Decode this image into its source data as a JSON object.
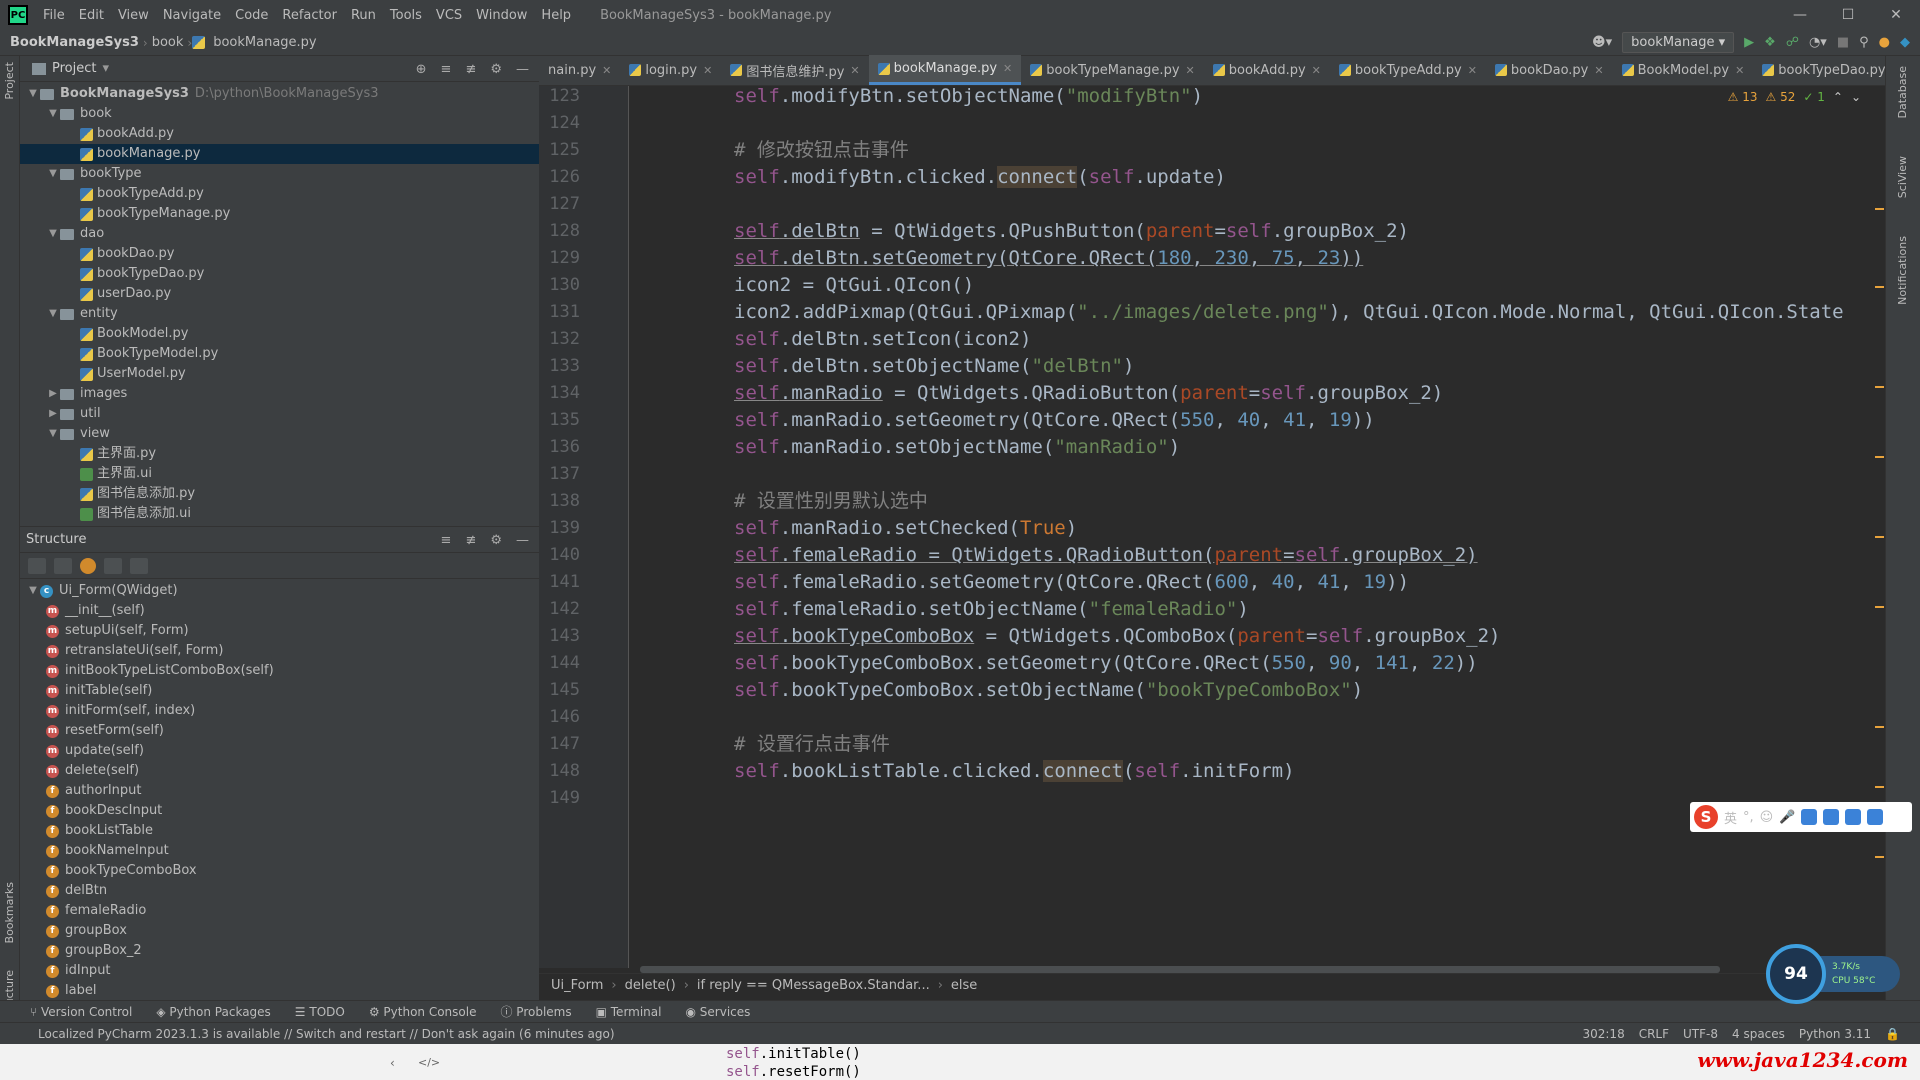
{
  "window": {
    "title": "BookManageSys3 - bookManage.py",
    "menu": [
      "File",
      "Edit",
      "View",
      "Navigate",
      "Code",
      "Refactor",
      "Run",
      "Tools",
      "VCS",
      "Window",
      "Help"
    ]
  },
  "navbar": {
    "crumbs": [
      "BookManageSys3",
      "book",
      "bookManage.py"
    ],
    "run_config": "bookManage"
  },
  "project": {
    "title": "Project",
    "tree": [
      {
        "label": "BookManageSys3",
        "path": "D:\\python\\BookManageSys3",
        "level": 0,
        "kind": "root"
      },
      {
        "label": "book",
        "level": 1,
        "kind": "folder"
      },
      {
        "label": "bookAdd.py",
        "level": 2,
        "kind": "py"
      },
      {
        "label": "bookManage.py",
        "level": 2,
        "kind": "py",
        "selected": true
      },
      {
        "label": "bookType",
        "level": 1,
        "kind": "folder"
      },
      {
        "label": "bookTypeAdd.py",
        "level": 2,
        "kind": "py"
      },
      {
        "label": "bookTypeManage.py",
        "level": 2,
        "kind": "py"
      },
      {
        "label": "dao",
        "level": 1,
        "kind": "folder"
      },
      {
        "label": "bookDao.py",
        "level": 2,
        "kind": "py"
      },
      {
        "label": "bookTypeDao.py",
        "level": 2,
        "kind": "py"
      },
      {
        "label": "userDao.py",
        "level": 2,
        "kind": "py"
      },
      {
        "label": "entity",
        "level": 1,
        "kind": "folder"
      },
      {
        "label": "BookModel.py",
        "level": 2,
        "kind": "py"
      },
      {
        "label": "BookTypeModel.py",
        "level": 2,
        "kind": "py"
      },
      {
        "label": "UserModel.py",
        "level": 2,
        "kind": "py"
      },
      {
        "label": "images",
        "level": 1,
        "kind": "folder-collapsed"
      },
      {
        "label": "util",
        "level": 1,
        "kind": "folder-collapsed"
      },
      {
        "label": "view",
        "level": 1,
        "kind": "folder"
      },
      {
        "label": "主界面.py",
        "level": 2,
        "kind": "py"
      },
      {
        "label": "主界面.ui",
        "level": 2,
        "kind": "ui"
      },
      {
        "label": "图书信息添加.py",
        "level": 2,
        "kind": "py"
      },
      {
        "label": "图书信息添加.ui",
        "level": 2,
        "kind": "ui"
      }
    ]
  },
  "structure": {
    "title": "Structure",
    "items": [
      {
        "label": "Ui_Form(QWidget)",
        "kind": "c",
        "level": 0
      },
      {
        "label": "__init__(self)",
        "kind": "m",
        "level": 1
      },
      {
        "label": "setupUi(self, Form)",
        "kind": "m",
        "level": 1
      },
      {
        "label": "retranslateUi(self, Form)",
        "kind": "m",
        "level": 1
      },
      {
        "label": "initBookTypeListComboBox(self)",
        "kind": "m",
        "level": 1
      },
      {
        "label": "initTable(self)",
        "kind": "m",
        "level": 1
      },
      {
        "label": "initForm(self, index)",
        "kind": "m",
        "level": 1
      },
      {
        "label": "resetForm(self)",
        "kind": "m",
        "level": 1
      },
      {
        "label": "update(self)",
        "kind": "m",
        "level": 1
      },
      {
        "label": "delete(self)",
        "kind": "m",
        "level": 1
      },
      {
        "label": "authorInput",
        "kind": "f",
        "level": 1
      },
      {
        "label": "bookDescInput",
        "kind": "f",
        "level": 1
      },
      {
        "label": "bookListTable",
        "kind": "f",
        "level": 1
      },
      {
        "label": "bookNameInput",
        "kind": "f",
        "level": 1
      },
      {
        "label": "bookTypeComboBox",
        "kind": "f",
        "level": 1
      },
      {
        "label": "delBtn",
        "kind": "f",
        "level": 1
      },
      {
        "label": "femaleRadio",
        "kind": "f",
        "level": 1
      },
      {
        "label": "groupBox",
        "kind": "f",
        "level": 1
      },
      {
        "label": "groupBox_2",
        "kind": "f",
        "level": 1
      },
      {
        "label": "idInput",
        "kind": "f",
        "level": 1
      },
      {
        "label": "label",
        "kind": "f",
        "level": 1
      }
    ]
  },
  "tabs": [
    {
      "label": "nain.py"
    },
    {
      "label": "login.py"
    },
    {
      "label": "图书信息维护.py"
    },
    {
      "label": "bookManage.py",
      "active": true
    },
    {
      "label": "bookTypeManage.py"
    },
    {
      "label": "bookAdd.py"
    },
    {
      "label": "bookTypeAdd.py"
    },
    {
      "label": "bookDao.py"
    },
    {
      "label": "BookModel.py"
    },
    {
      "label": "bookTypeDao.py"
    }
  ],
  "inspections": {
    "warnings": "13",
    "weak_warnings": "52",
    "ok": "1"
  },
  "editor": {
    "lines": [
      {
        "n": "123",
        "html": "<span class='self'>self</span>.modifyBtn.setObjectName(<span class='str'>\"modifyBtn\"</span>)"
      },
      {
        "n": "124",
        "html": ""
      },
      {
        "n": "125",
        "html": "<span class='cm'># 修改按钮点击事件</span>"
      },
      {
        "n": "126",
        "html": "<span class='self'>self</span>.modifyBtn.clicked.<span class='hl'>connect</span>(<span class='self'>self</span>.update)"
      },
      {
        "n": "127",
        "html": ""
      },
      {
        "n": "128",
        "html": "<span class='ul'><span class='self'>self</span>.delBtn</span> = QtWidgets.QPushButton(<span class='pm'>parent</span>=<span class='self'>self</span>.groupBox_2)"
      },
      {
        "n": "129",
        "html": "<span class='ul'><span class='self'>self</span>.delBtn.setGeometry(QtCore.QRect(<span class='num'>180</span>, <span class='num'>230</span>, <span class='num'>75</span>, <span class='num'>23</span>))</span>"
      },
      {
        "n": "130",
        "html": "icon2 = QtGui.QIcon()"
      },
      {
        "n": "131",
        "html": "icon2.addPixmap(QtGui.QPixmap(<span class='str'>\"../images/delete.png\"</span>), QtGui.QIcon.Mode.Normal, QtGui.QIcon.State"
      },
      {
        "n": "132",
        "html": "<span class='self'>self</span>.delBtn.setIcon(icon2)"
      },
      {
        "n": "133",
        "html": "<span class='self'>self</span>.delBtn.setObjectName(<span class='str'>\"delBtn\"</span>)"
      },
      {
        "n": "134",
        "html": "<span class='ul'><span class='self'>self</span>.manRadio</span> = QtWidgets.QRadioButton(<span class='pm'>parent</span>=<span class='self'>self</span>.groupBox_2)"
      },
      {
        "n": "135",
        "html": "<span class='self'>self</span>.manRadio.setGeometry(QtCore.QRect(<span class='num'>550</span>, <span class='num'>40</span>, <span class='num'>41</span>, <span class='num'>19</span>))"
      },
      {
        "n": "136",
        "html": "<span class='self'>self</span>.manRadio.setObjectName(<span class='str'>\"manRadio\"</span>)"
      },
      {
        "n": "137",
        "html": ""
      },
      {
        "n": "138",
        "html": "<span class='cm'># 设置性别男默认选中</span>"
      },
      {
        "n": "139",
        "html": "<span class='self'>self</span>.manRadio.setChecked(<span class='kw'>True</span>)"
      },
      {
        "n": "140",
        "html": "<span class='ul'><span class='self'>self</span>.femaleRadio = QtWidgets.QRadioButton(<span class='pm'>parent</span>=<span class='self'>self</span>.groupBox_2)</span>"
      },
      {
        "n": "141",
        "html": "<span class='self'>self</span>.femaleRadio.setGeometry(QtCore.QRect(<span class='num'>600</span>, <span class='num'>40</span>, <span class='num'>41</span>, <span class='num'>19</span>))"
      },
      {
        "n": "142",
        "html": "<span class='self'>self</span>.femaleRadio.setObjectName(<span class='str'>\"femaleRadio\"</span>)"
      },
      {
        "n": "143",
        "html": "<span class='ul'><span class='self'>self</span>.bookTypeComboBox</span> = QtWidgets.QComboBox(<span class='pm'>parent</span>=<span class='self'>self</span>.groupBox_2)"
      },
      {
        "n": "144",
        "html": "<span class='self'>self</span>.bookTypeComboBox.setGeometry(QtCore.QRect(<span class='num'>550</span>, <span class='num'>90</span>, <span class='num'>141</span>, <span class='num'>22</span>))"
      },
      {
        "n": "145",
        "html": "<span class='self'>self</span>.bookTypeComboBox.setObjectName(<span class='str'>\"bookTypeComboBox\"</span>)"
      },
      {
        "n": "146",
        "html": ""
      },
      {
        "n": "147",
        "html": "<span class='cm'># 设置行点击事件</span>"
      },
      {
        "n": "148",
        "html": "<span class='self'>self</span>.bookListTable.clicked.<span class='hl'>connect</span>(<span class='self'>self</span>.initForm)"
      },
      {
        "n": "149",
        "html": ""
      }
    ]
  },
  "breadcrumbs": [
    "Ui_Form",
    "delete()",
    "if reply == QMessageBox.Standar...",
    "else"
  ],
  "tool_tabs": [
    "Version Control",
    "Python Packages",
    "TODO",
    "Python Console",
    "Problems",
    "Terminal",
    "Services"
  ],
  "status": {
    "message": "Localized PyCharm 2023.1.3 is available // Switch and restart // Don't ask again (6 minutes ago)",
    "position": "302:18",
    "line_sep": "CRLF",
    "encoding": "UTF-8",
    "indent": "4 spaces",
    "interpreter": "Python 3.11"
  },
  "side_labels": {
    "project": "Project",
    "bookmarks": "Bookmarks",
    "structure": "Structure",
    "database": "Database",
    "sciview": "SciView",
    "notifications": "Notifications"
  },
  "overlay": {
    "code_lines": [
      "self.initTable()",
      "self.resetForm()"
    ],
    "watermark": "www.java1234.com",
    "ime_lang": "英",
    "perf_percent": "94",
    "perf_net": "3.7K/s",
    "perf_cpu": "CPU 58°C"
  }
}
